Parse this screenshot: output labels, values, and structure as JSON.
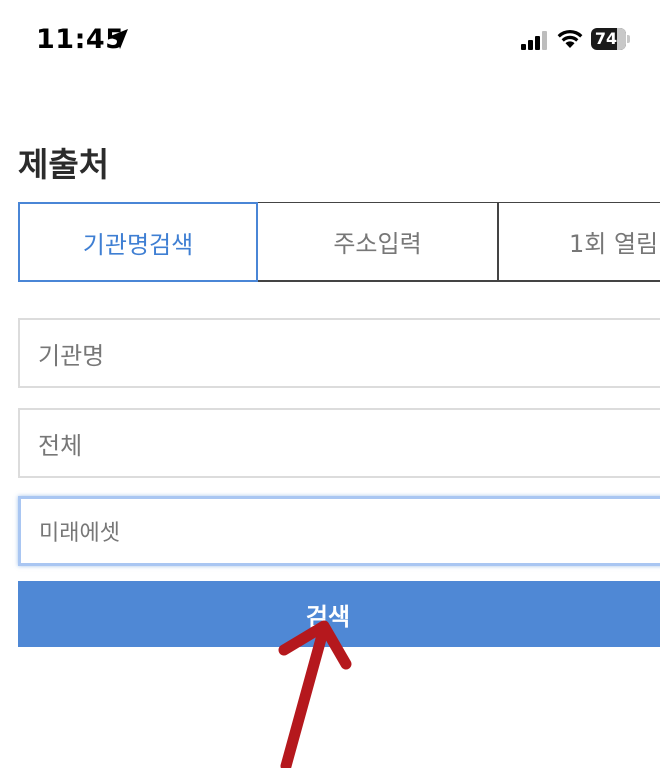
{
  "status_bar": {
    "time": "11:45",
    "battery_level": "74"
  },
  "form": {
    "title": "제출처",
    "tabs": [
      {
        "label": "기관명검색",
        "active": true
      },
      {
        "label": "주소입력",
        "active": false
      },
      {
        "label": "1회 열림",
        "active": false
      }
    ],
    "fields": {
      "org_name": "기관명",
      "category": "전체",
      "query": "미래에셋"
    },
    "search_button": "검색"
  },
  "colors": {
    "accent": "#4f88d5",
    "active_tab_text": "#3f7fd3",
    "annotation_arrow": "#b5181d"
  },
  "icons": {
    "location": "location-arrow-icon",
    "signal": "cellular-signal-icon",
    "wifi": "wifi-icon",
    "battery": "battery-icon"
  }
}
